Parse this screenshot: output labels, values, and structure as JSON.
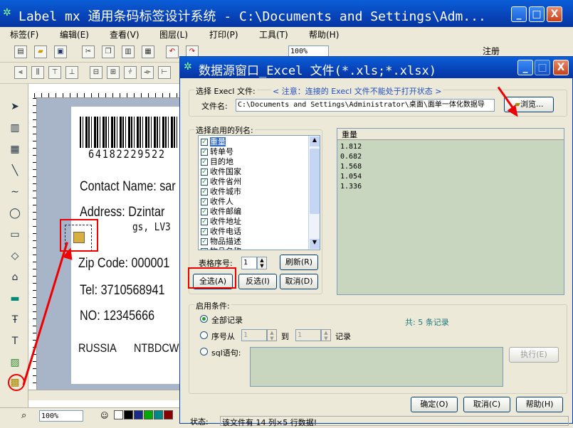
{
  "window": {
    "title": "Label mx 通用条码标签设计系统 - C:\\Documents and Settings\\Adm...",
    "min_label": "_",
    "max_label": "□",
    "close_label": "X"
  },
  "menu": [
    "标签(F)",
    "编辑(E)",
    "查看(V)",
    "图层(L)",
    "打印(P)",
    "工具(T)",
    "帮助(H)"
  ],
  "toolbar": {
    "zoom": "100%",
    "register_label": "注册"
  },
  "label_preview": {
    "barcode_number": "64182229522",
    "contact": "Contact Name: sar",
    "address_line1": "Address: Dzintar",
    "address_line2": "gs, LV3",
    "zip": "Zip Code: 000001",
    "tel": "Tel:  3710568941",
    "no": "NO:  12345666",
    "country": "RUSSIA",
    "code": "NTBDCW"
  },
  "statusbar": {
    "zoom": "100%"
  },
  "dialog": {
    "title": "数据源窗口_Excel 文件(*.xls;*.xlsx)",
    "file_group_label": "选择 Execl 文件:",
    "notice": "< 注意：连接的 Execl 文件不能处于打开状态 >",
    "filename_label": "文件名:",
    "filename_value": "C:\\Documents and Settings\\Administrator\\桌面\\面单一体化数据导",
    "browse_label": "浏览...",
    "columns_group_label": "选择启用的列名:",
    "columns": [
      "重量",
      "转单号",
      "目的地",
      "收件国家",
      "收件省州",
      "收件城市",
      "收件人",
      "收件邮编",
      "收件地址",
      "收件电话",
      "物品描述",
      "物品名称"
    ],
    "sheet_label": "表格序号:",
    "sheet_value": "1",
    "refresh_label": "刷新(R)",
    "select_all_label": "全选(A)",
    "invert_label": "反选(I)",
    "cancel_sel_label": "取消(D)",
    "grid_header": "重量",
    "grid_values": [
      "1.812",
      "0.682",
      "1.568",
      "1.054",
      "1.336"
    ],
    "condition_group_label": "启用条件:",
    "all_records_label": "全部记录",
    "record_count": "共: 5 条记录",
    "range_from_label": "序号从",
    "range_from_value": "1",
    "range_to_label": "到",
    "range_to_value": "1",
    "range_unit_label": "记录",
    "sql_label": "sql语句:",
    "execute_label": "执行(E)",
    "ok_label": "确定(O)",
    "cancel_label": "取消(C)",
    "help_label": "帮助(H)",
    "status_label": "状态:",
    "status_text": "该文件有 14 列×5 行数据!"
  },
  "colors": {
    "title_blue": "#0842b8",
    "annotation_red": "#e00000",
    "grid_bg": "#c8d6c0"
  }
}
